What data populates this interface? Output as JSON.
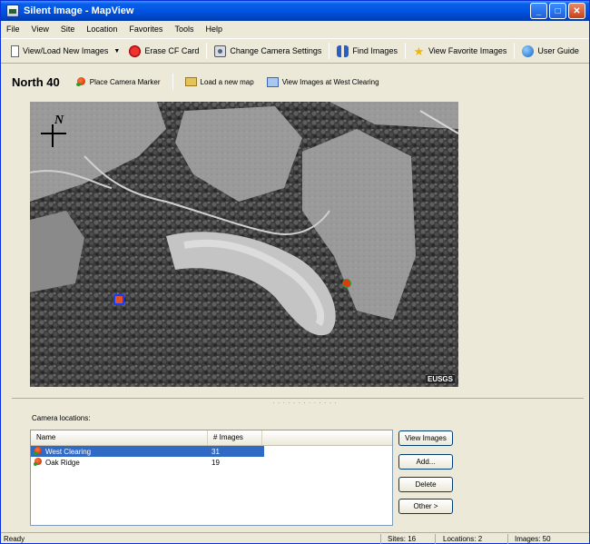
{
  "window": {
    "title": "Silent Image - MapView",
    "minimize": "_",
    "maximize": "□",
    "close": "✕"
  },
  "menu": [
    "File",
    "View",
    "Site",
    "Location",
    "Favorites",
    "Tools",
    "Help"
  ],
  "toolbar": {
    "view_load": "View/Load New Images",
    "erase_cf": "Erase CF Card",
    "change_camera": "Change Camera Settings",
    "find_images": "Find Images",
    "view_favorites": "View Favorite Images",
    "user_guide": "User Guide"
  },
  "map": {
    "title": "North 40",
    "place_marker": "Place Camera Marker",
    "load_map": "Load a new map",
    "view_images_at": "View Images at West Clearing",
    "compass_letter": "N",
    "ortho_label": "EUSGS"
  },
  "camera_locations": {
    "label": "Camera locations:",
    "columns": [
      "Name",
      "# Images"
    ],
    "rows": [
      {
        "name": "West Clearing",
        "images": "31",
        "selected": true
      },
      {
        "name": "Oak Ridge",
        "images": "19",
        "selected": false
      }
    ],
    "buttons": {
      "view_images": "View Images",
      "add": "Add...",
      "delete": "Delete",
      "other": "Other >"
    }
  },
  "status": {
    "ready": "Ready",
    "sites": "Sites: 16",
    "locations": "Locations: 2",
    "images": "Images: 50"
  }
}
